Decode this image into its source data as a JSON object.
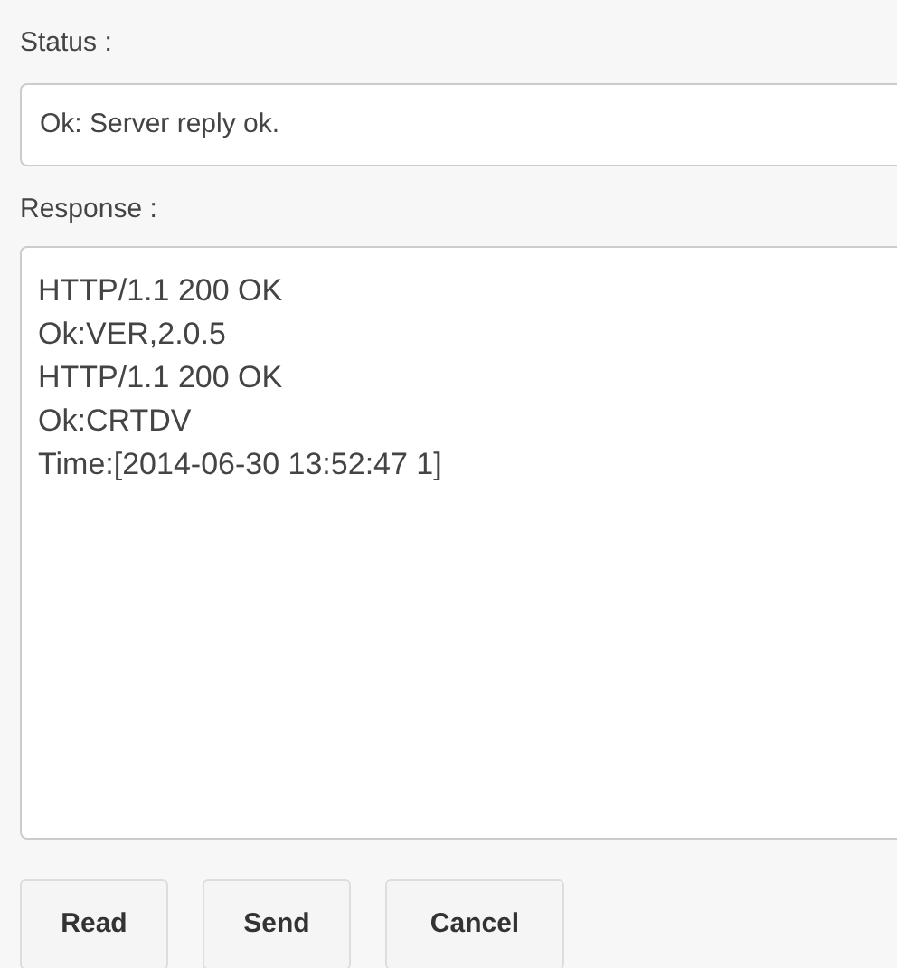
{
  "status": {
    "label": "Status :",
    "value": "Ok: Server reply ok."
  },
  "response": {
    "label": "Response :",
    "value": "HTTP/1.1 200 OK\nOk:VER,2.0.5\nHTTP/1.1 200 OK\nOk:CRTDV\nTime:[2014-06-30 13:52:47 1]"
  },
  "buttons": [
    "Read",
    "Send",
    "Cancel"
  ]
}
